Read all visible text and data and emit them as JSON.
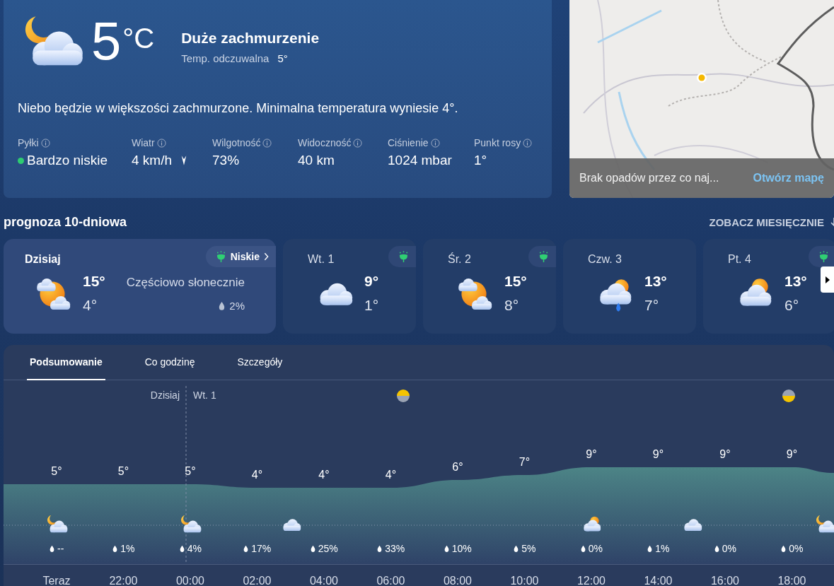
{
  "current": {
    "temperature": "5",
    "unit": "°C",
    "kind": "moon-cloud",
    "condition": "Duże zachmurzenie",
    "feels_like_label": "Temp. odczuwalna",
    "feels_like": "5°",
    "summary": "Niebo będzie w większości zachmurzone. Minimalna temperatura wyniesie 4°.",
    "stats": [
      {
        "label": "Pyłki",
        "value": "Bardzo niskie",
        "kind": "pollen"
      },
      {
        "label": "Wiatr",
        "value": "4 km/h",
        "kind": "wind"
      },
      {
        "label": "Wilgotność",
        "value": "73%",
        "kind": "plain"
      },
      {
        "label": "Widoczność",
        "value": "40 km",
        "kind": "plain"
      },
      {
        "label": "Ciśnienie",
        "value": "1024 mbar",
        "kind": "plain"
      },
      {
        "label": "Punkt rosy",
        "value": "1°",
        "kind": "plain"
      }
    ]
  },
  "map": {
    "caption": "Brak opadów przez co naj...",
    "link": "Otwórz mapę"
  },
  "forecast": {
    "title": "prognoza 10-dniowa",
    "monthly_link": "ZOBACZ MIESIĘCZNIE",
    "days": [
      {
        "day": "Dzisiaj",
        "hi": "15°",
        "lo": "4°",
        "kind": "partly-sunny",
        "selected": true,
        "pollen": true,
        "pollen_label": "Niskie",
        "condition": "Częściowo słonecznie",
        "precip": "2%"
      },
      {
        "day": "Wt. 1",
        "hi": "9°",
        "lo": "1°",
        "kind": "cloud",
        "selected": false,
        "pollen": true
      },
      {
        "day": "Śr. 2",
        "hi": "15°",
        "lo": "8°",
        "kind": "partly-sunny",
        "selected": false,
        "pollen": true
      },
      {
        "day": "Czw. 3",
        "hi": "13°",
        "lo": "7°",
        "kind": "sun-rain",
        "selected": false,
        "pollen": false
      },
      {
        "day": "Pt. 4",
        "hi": "13°",
        "lo": "6°",
        "kind": "sun-cloud",
        "selected": false,
        "pollen": true
      }
    ]
  },
  "details": {
    "tabs": [
      {
        "label": "Podsumowanie",
        "selected": true
      },
      {
        "label": "Co godzinę",
        "selected": false
      },
      {
        "label": "Szczegóły",
        "selected": false
      }
    ],
    "day_labels": [
      "Dzisiaj",
      "Wt. 1"
    ],
    "hours": [
      {
        "time": "Teraz",
        "temp": "5°",
        "precip": "--",
        "kind": "moon-cloud"
      },
      {
        "time": "22:00",
        "temp": "5°",
        "precip": "1%"
      },
      {
        "time": "00:00",
        "temp": "5°",
        "precip": "4%",
        "kind": "moon-cloud"
      },
      {
        "time": "02:00",
        "temp": "4°",
        "precip": "17%",
        "kind": "cloud"
      },
      {
        "time": "04:00",
        "temp": "4°",
        "precip": "25%"
      },
      {
        "time": "06:00",
        "temp": "4°",
        "precip": "33%"
      },
      {
        "time": "08:00",
        "temp": "6°",
        "precip": "10%"
      },
      {
        "time": "10:00",
        "temp": "7°",
        "precip": "5%"
      },
      {
        "time": "12:00",
        "temp": "9°",
        "precip": "0%",
        "kind": "sun-cloud"
      },
      {
        "time": "14:00",
        "temp": "9°",
        "precip": "1%",
        "kind": "cloud"
      },
      {
        "time": "16:00",
        "temp": "9°",
        "precip": "0%"
      },
      {
        "time": "18:00",
        "temp": "9°",
        "precip": "0%",
        "kind": "moon-cloud"
      }
    ]
  }
}
